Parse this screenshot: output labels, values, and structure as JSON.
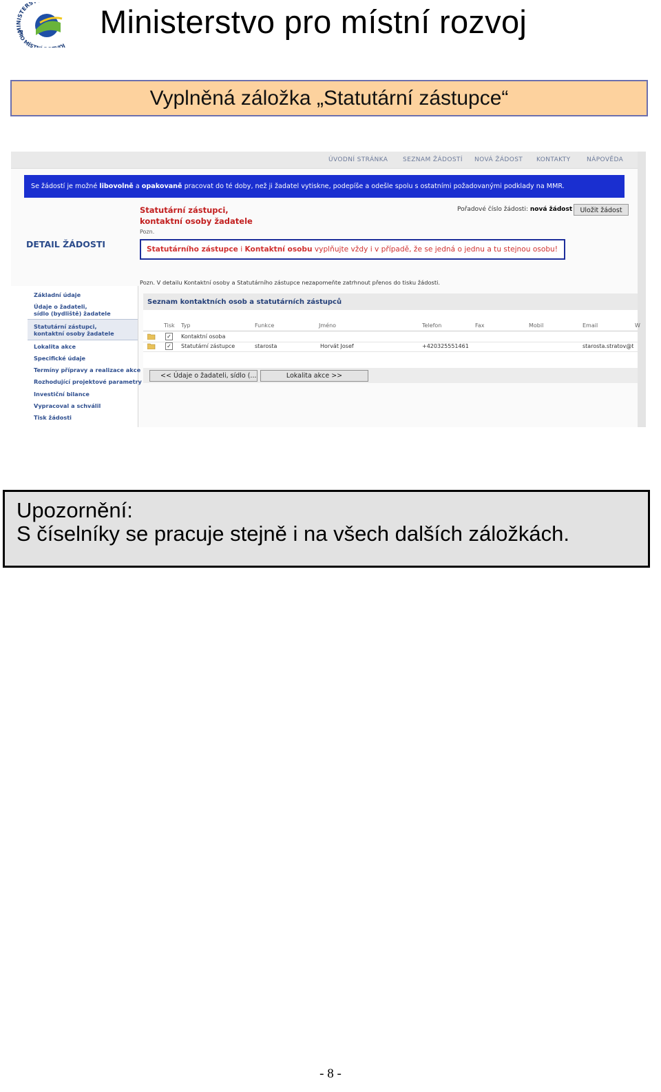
{
  "header": {
    "title": "Ministerstvo pro místní rozvoj",
    "logo_top_text": "MINISTERSTVO",
    "logo_bottom_text": "PRO MÍSTNÍ ROZVOJ"
  },
  "banner": {
    "text": "Vyplněná záložka „Statutární zástupce“"
  },
  "screenshot": {
    "topnav": [
      "ÚVODNÍ STRÁNKA",
      "SEZNAM ŽÁDOSTÍ",
      "NOVÁ ŽÁDOST",
      "KONTAKTY",
      "NÁPOVĚDA"
    ],
    "infobar": {
      "p1": "Se žádostí je možné ",
      "b1": "libovolně",
      "p2": " a ",
      "b2": "opakovaně",
      "p3": " pracovat do té doby, než ji žadatel vytiskne, podepíše a odešle spolu s ostatními požadovanými podklady na MMR."
    },
    "section_title_line1": "Statutární zástupci,",
    "section_title_line2": "kontaktní osoby žadatele",
    "pozn1": "Pozn.",
    "order_label": "Pořadové číslo žádosti: ",
    "order_value": "nová žádost",
    "save_button": "Uložit žádost",
    "detail_title": "DETAIL ŽÁDOSTI",
    "notice": {
      "b1": "Statutárního zástupce",
      "p1": " i ",
      "b2": "Kontaktní osobu",
      "p2": " vyplňujte vždy i v případě, že se jedná o jednu a tu stejnou osobu!"
    },
    "pozn2": "Pozn. V detailu Kontaktní osoby a Statutárního zástupce nezapomeňte zatrhnout přenos do tisku žádosti.",
    "sidebar": [
      "Základní údaje",
      "Údaje o žadateli,\nsídlo (bydliště) žadatele",
      "Statutární zástupci,\nkontaktní osoby žadatele",
      "Lokalita akce",
      "Specifické údaje",
      "Termíny přípravy a realizace akce",
      "Rozhodující projektové parametry",
      "Investiční bilance",
      "Vypracoval a schválil",
      "Tisk žádosti"
    ],
    "table": {
      "title": "Seznam kontaktních osob a statutárních zástupců",
      "headers": [
        "Tisk",
        "Typ",
        "Funkce",
        "Jméno",
        "Telefon",
        "Fax",
        "Mobil",
        "Email",
        "W"
      ],
      "rows": [
        {
          "checked": "✓",
          "typ": "Kontaktní osoba",
          "funkce": "",
          "jmeno": "",
          "telefon": "",
          "email": ""
        },
        {
          "checked": "✓",
          "typ": "Statutární zástupce",
          "funkce": "starosta",
          "jmeno": "Horvát Josef",
          "telefon": "+420325551461",
          "email": "starosta.stratov@t"
        }
      ]
    },
    "prev_button": "<<  Údaje o žadateli, sídlo (...",
    "next_button": "Lokalita akce  >>",
    "colors": {
      "infobar": "#1a2fd0",
      "accent_red": "#c21f1f"
    }
  },
  "warning": {
    "label": "Upozornění:",
    "text": "S číselníky se pracuje stejně i na všech dalších záložkách."
  },
  "footer": {
    "page": "- 8 -"
  }
}
